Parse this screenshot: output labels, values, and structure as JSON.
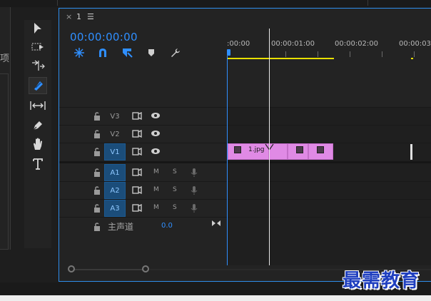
{
  "left_panel": {
    "label": "项"
  },
  "tabs": {
    "close": "×",
    "name": "1",
    "menu": "☰"
  },
  "timeline": {
    "timecode": "00:00:00:00",
    "ruler": [
      ":00:00",
      "00:00:01:00",
      "00:00:02:00",
      "00:00:03:"
    ],
    "video_tracks": [
      "V3",
      "V2",
      "V1"
    ],
    "audio_tracks": [
      {
        "name": "A1",
        "mute": "M",
        "solo": "S"
      },
      {
        "name": "A2",
        "mute": "M",
        "solo": "S"
      },
      {
        "name": "A3",
        "mute": "M",
        "solo": "S"
      }
    ],
    "master": {
      "label": "主声道",
      "value": "0.0"
    },
    "clip": {
      "name": "1.jpg"
    }
  },
  "watermark": "最需教育",
  "colors": {
    "accent": "#2f8fff",
    "clip": "#e08ae5",
    "work_area": "#e8e000",
    "active_track": "#1b4d7a"
  },
  "icons": {
    "tools": [
      "selection-tool-icon",
      "track-select-forward-icon",
      "ripple-edit-icon",
      "razor-tool-icon",
      "slip-tool-icon",
      "pen-tool-icon",
      "hand-tool-icon",
      "type-tool-icon"
    ],
    "timeline_buttons": [
      "nest-sequence-icon",
      "snap-magnet-icon",
      "linked-selection-icon",
      "add-marker-icon",
      "timeline-settings-wrench-icon"
    ]
  }
}
